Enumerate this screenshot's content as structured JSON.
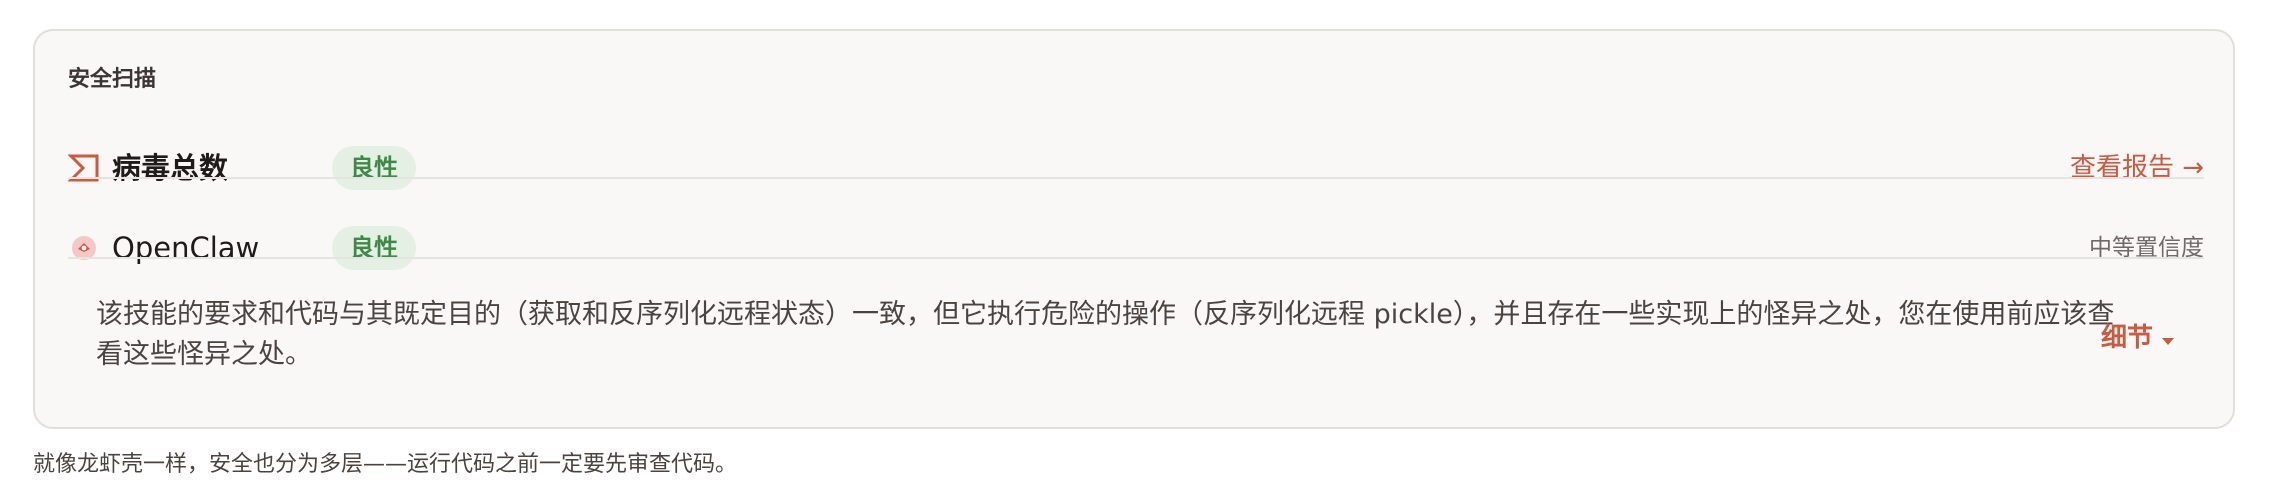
{
  "security_scan": {
    "title": "安全扫描",
    "rows": [
      {
        "icon": "sigma-icon",
        "name": "病毒总数",
        "badge": "良性",
        "right_text": "查看报告 →"
      },
      {
        "icon": "openclaw-logo-icon",
        "name": "OpenClaw",
        "badge": "良性",
        "right_text": "中等置信度"
      }
    ],
    "summary": "该技能的要求和代码与其既定目的（获取和反序列化远程状态）一致，但它执行危险的操作（反序列化远程 pickle），并且存在一些实现上的怪异之处，您在使用前应该查看这些怪异之处。",
    "details_label": "细节"
  },
  "caption": "就像龙虾壳一样，安全也分为多层——运行代码之前一定要先审查代码。",
  "colors": {
    "accent": "#cc5a3f",
    "benign_text": "#3d8a46",
    "benign_bg": "#e4f0e4",
    "card_bg": "#f9f8f7",
    "card_border": "#e1dfdd"
  }
}
